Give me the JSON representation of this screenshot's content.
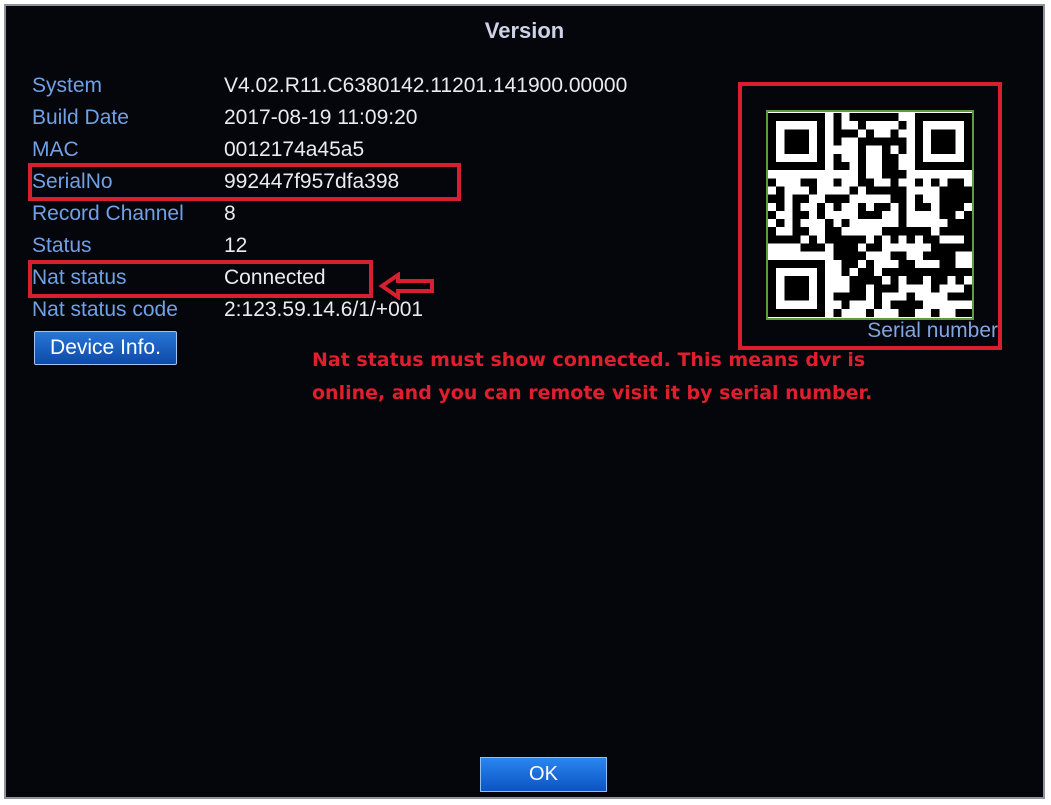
{
  "dialog": {
    "title": "Version"
  },
  "info": {
    "rows": [
      {
        "label": "System",
        "value": "V4.02.R11.C6380142.11201.141900.00000"
      },
      {
        "label": "Build Date",
        "value": "2017-08-19 11:09:20"
      },
      {
        "label": "MAC",
        "value": "0012174a45a5"
      },
      {
        "label": "SerialNo",
        "value": "992447f957dfa398"
      },
      {
        "label": "Record Channel",
        "value": "8"
      },
      {
        "label": "Status",
        "value": "12"
      },
      {
        "label": "Nat status",
        "value": "Connected"
      },
      {
        "label": "Nat status code",
        "value": "2:123.59.14.6/1/+001"
      }
    ]
  },
  "buttons": {
    "device_info": "Device Info.",
    "ok": "OK"
  },
  "qr": {
    "caption": "Serial number"
  },
  "annotation": {
    "line1": "Nat status must show connected. This means dvr is",
    "line2": "online, and you can remote visit it by serial number."
  },
  "colors": {
    "dialog_background": "#05050c",
    "label_text": "#6fa1e5",
    "value_text": "#e9ebf1",
    "highlight": "#d81f30",
    "button": "#1565cc"
  },
  "icons": {
    "arrow": "left-arrow-icon",
    "qr": "qr-code-icon"
  }
}
